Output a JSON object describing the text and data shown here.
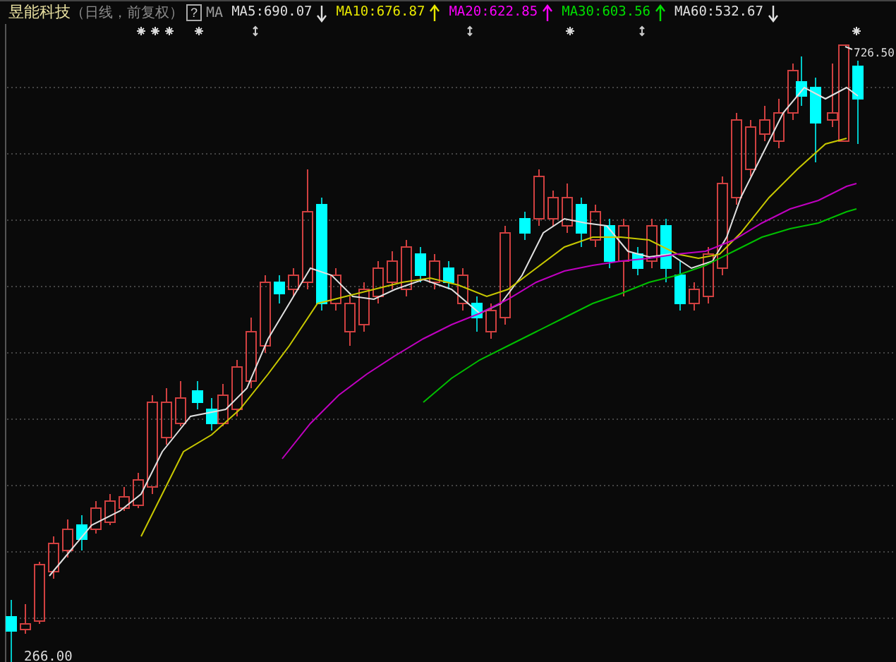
{
  "header": {
    "title": "昱能科技",
    "subtitle": "（日线，前复权）",
    "help": "?",
    "ma_label": "MA",
    "indicators": [
      {
        "label": "MA5:690.07",
        "color": "#e0e0e0",
        "kind": "down"
      },
      {
        "label": "MA10:676.87",
        "color": "#e8e800",
        "kind": "up"
      },
      {
        "label": "MA20:622.85",
        "color": "#ff00ff",
        "kind": "up"
      },
      {
        "label": "MA30:603.56",
        "color": "#00e000",
        "kind": "up"
      },
      {
        "label": "MA60:532.67",
        "color": "#e0e0e0",
        "kind": "down"
      }
    ]
  },
  "chart": {
    "high_label": "726.50",
    "low_label": "266.00"
  }
}
